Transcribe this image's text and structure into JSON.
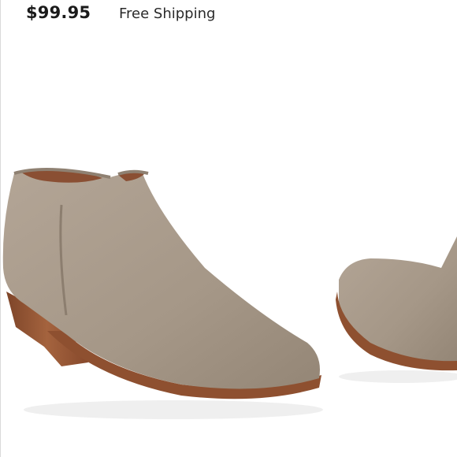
{
  "listing": {
    "price": "$99.95",
    "shipping_label": "Free Shipping"
  },
  "product_image": {
    "icon": "ankle-boot-photo",
    "colors": {
      "suede": "#a8998a",
      "suede_shadow": "#8f8172",
      "lining": "#8a4f33",
      "heel": "#9b5a37",
      "sole": "#8e5030"
    }
  }
}
